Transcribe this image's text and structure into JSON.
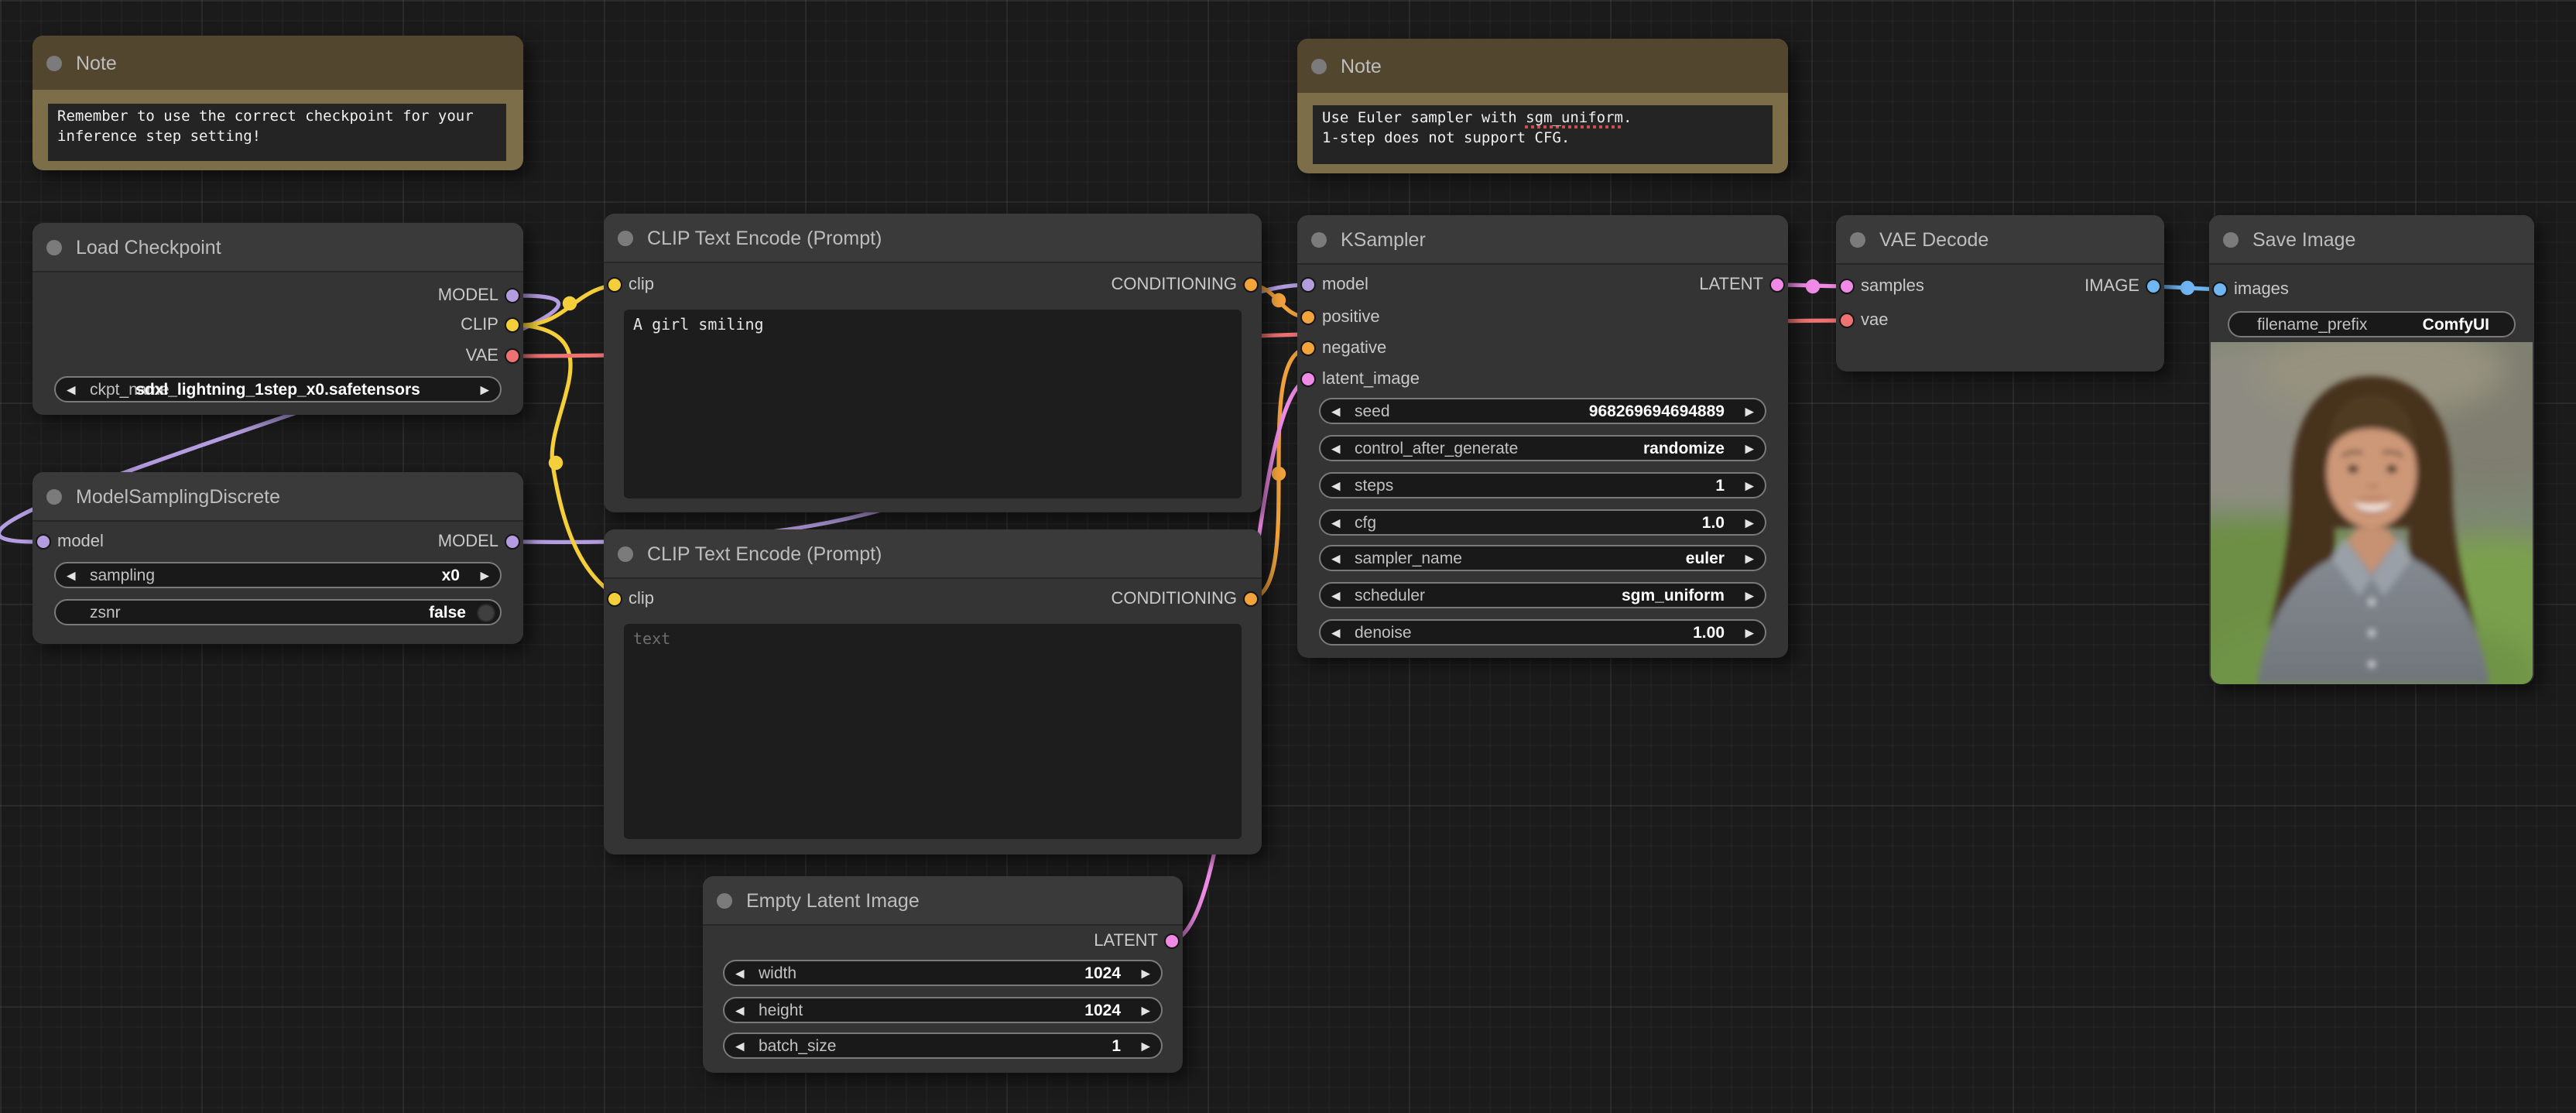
{
  "graph_colors": {
    "MODEL": "#b49ce0",
    "CLIP": "#f5cf3a",
    "VAE": "#ee7272",
    "CONDITIONING": "#f2a33c",
    "LATENT": "#ef8be6",
    "IMAGE": "#6fb6f2"
  },
  "nodes": {
    "note_left": {
      "title": "Note",
      "text": "Remember to use the correct checkpoint for your\ninference step setting!"
    },
    "note_right": {
      "title": "Note",
      "line1_prefix": "Use Euler sampler with ",
      "line1_highlight": "sgm_uniform",
      "line1_suffix": ".",
      "line2": "1-step does not support CFG."
    },
    "load_checkpoint": {
      "title": "Load Checkpoint",
      "outputs": [
        "MODEL",
        "CLIP",
        "VAE"
      ],
      "widgets": [
        {
          "label": "ckpt_name",
          "value": "sdxl_lightning_1step_x0.safetensors"
        }
      ]
    },
    "model_sampling_discrete": {
      "title": "ModelSamplingDiscrete",
      "inputs": [
        "model"
      ],
      "outputs": [
        "MODEL"
      ],
      "widgets": [
        {
          "label": "sampling",
          "value": "x0"
        },
        {
          "label": "zsnr",
          "value": "false"
        }
      ]
    },
    "clip_text_encode_positive": {
      "title": "CLIP Text Encode (Prompt)",
      "inputs": [
        "clip"
      ],
      "outputs": [
        "CONDITIONING"
      ],
      "prompt": "A girl smiling"
    },
    "clip_text_encode_negative": {
      "title": "CLIP Text Encode (Prompt)",
      "inputs": [
        "clip"
      ],
      "outputs": [
        "CONDITIONING"
      ],
      "prompt_placeholder": "text"
    },
    "empty_latent_image": {
      "title": "Empty Latent Image",
      "outputs": [
        "LATENT"
      ],
      "widgets": [
        {
          "label": "width",
          "value": "1024"
        },
        {
          "label": "height",
          "value": "1024"
        },
        {
          "label": "batch_size",
          "value": "1"
        }
      ]
    },
    "ksampler": {
      "title": "KSampler",
      "inputs": [
        "model",
        "positive",
        "negative",
        "latent_image"
      ],
      "outputs": [
        "LATENT"
      ],
      "widgets": [
        {
          "label": "seed",
          "value": "968269694694889"
        },
        {
          "label": "control_after_generate",
          "value": "randomize"
        },
        {
          "label": "steps",
          "value": "1"
        },
        {
          "label": "cfg",
          "value": "1.0"
        },
        {
          "label": "sampler_name",
          "value": "euler"
        },
        {
          "label": "scheduler",
          "value": "sgm_uniform"
        },
        {
          "label": "denoise",
          "value": "1.00"
        }
      ]
    },
    "vae_decode": {
      "title": "VAE Decode",
      "inputs": [
        "samples",
        "vae"
      ],
      "outputs": [
        "IMAGE"
      ]
    },
    "save_image": {
      "title": "Save Image",
      "inputs": [
        "images"
      ],
      "widgets": [
        {
          "label": "filename_prefix",
          "value": "ComfyUI"
        }
      ],
      "preview_description": "Generated image preview: smiling woman with long brown hair in a gray shirt, blurred outdoor background"
    }
  }
}
